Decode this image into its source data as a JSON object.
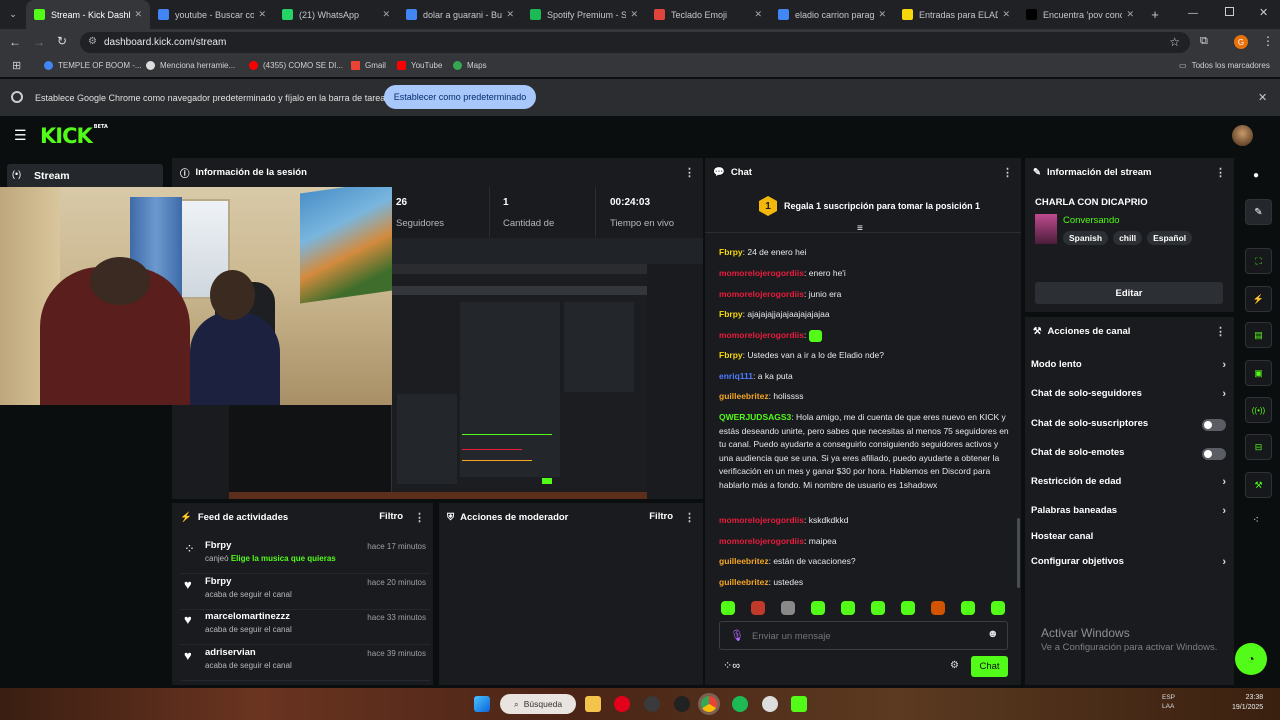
{
  "browser": {
    "tabs": [
      {
        "title": "Stream - Kick Dashboard",
        "active": true,
        "color": "#53fc18"
      },
      {
        "title": "youtube - Buscar con Google",
        "active": false,
        "color": "#4285f4"
      },
      {
        "title": "(21) WhatsApp",
        "active": false,
        "color": "#25d366"
      },
      {
        "title": "dolar a guarani - Buscar con Google",
        "active": false,
        "color": "#4285f4"
      },
      {
        "title": "Spotify Premium - Spotify",
        "active": false,
        "color": "#1db954"
      },
      {
        "title": "Teclado Emoji",
        "active": false,
        "color": "#e0443d"
      },
      {
        "title": "eladio carrion paraguay",
        "active": false,
        "color": "#4285f4"
      },
      {
        "title": "Entradas para ELADIO",
        "active": false,
        "color": "#f5d70b"
      },
      {
        "title": "Encuentra 'pov concierto'",
        "active": false,
        "color": "#000000"
      }
    ],
    "url": "dashboard.kick.com/stream",
    "bookmarks": [
      "TEMPLE OF BOOM -...",
      "Menciona herramie...",
      "(4355) COMO SE DI...",
      "Gmail",
      "YouTube",
      "Maps"
    ],
    "bookmarks_all": "Todos los marcadores",
    "profile_letter": "G",
    "infobar_text": "Establece Google Chrome como navegador predeterminado y fíjalo en la barra de tareas",
    "infobar_button": "Establecer como predeterminado"
  },
  "kick": {
    "logo": "KICK",
    "logo_badge": "BETA",
    "nav_stream": "Stream",
    "session": {
      "title": "Información de la sesión",
      "stats": [
        {
          "value": "26",
          "label": "Seguidores"
        },
        {
          "value": "1",
          "label": "Cantidad de"
        },
        {
          "value": "00:24:03",
          "label": "Tiempo en vivo"
        }
      ]
    },
    "chat": {
      "title": "Chat",
      "pinned": "Regala 1 suscripción para tomar la posición 1",
      "pinned_rank": "1",
      "messages": [
        {
          "user": "Fbrpy",
          "color": "#f5d70b",
          "text": "24 de enero hei"
        },
        {
          "user": "momorelojerogordiis",
          "color": "#e91c3c",
          "text": "enero he'i"
        },
        {
          "user": "momorelojerogordiis",
          "color": "#e91c3c",
          "text": "junio era"
        },
        {
          "user": "Fbrpy",
          "color": "#f5d70b",
          "text": "ajajajajjajajaajajajajaa"
        },
        {
          "user": "momorelojerogordiis",
          "color": "#e91c3c",
          "text": ""
        },
        {
          "user": "Fbrpy",
          "color": "#f5d70b",
          "text": "Ustedes van a ir a lo de Eladio nde?"
        },
        {
          "user": "enriq111",
          "color": "#4f7cff",
          "text": "a ka puta"
        },
        {
          "user": "guilleebritez",
          "color": "#f5a623",
          "text": "holissss"
        },
        {
          "user": "QWERJUDSAGS3",
          "color": "#53fc18",
          "text": "Hola amigo, me di cuenta de que eres nuevo en KICK y estás deseando unirte, pero sabes que necesitas al menos 75 seguidores en tu canal. Puedo ayudarte a conseguirlo consiguiendo seguidores activos y una audiencia que se una. Si ya eres afiliado, puedo ayudarte a obtener la verificación en un mes y ganar $30 por hora. Hablemos en Discord para hablarlo más a fondo. Mi nombre de usuario es 1shadowx"
        },
        {
          "user": "momorelojerogordiis",
          "color": "#e91c3c",
          "text": "kskdkdkkd"
        },
        {
          "user": "momorelojerogordiis",
          "color": "#e91c3c",
          "text": "maipea"
        },
        {
          "user": "guilleebritez",
          "color": "#f5a623",
          "text": "están de vacaciones?"
        },
        {
          "user": "guilleebritez",
          "color": "#f5a623",
          "text": "ustedes"
        }
      ],
      "input_placeholder": "Enviar un mensaje",
      "send_button": "Chat"
    },
    "stream_info": {
      "title": "Información del stream",
      "stream_title": "CHARLA CON DICAPRIO",
      "category": "Conversando",
      "tags": [
        "Spanish",
        "chill",
        "Español"
      ],
      "edit_button": "Editar"
    },
    "channel_actions": {
      "title": "Acciones de canal",
      "items": [
        {
          "label": "Modo lento",
          "control": "chevron"
        },
        {
          "label": "Chat de solo-seguidores",
          "control": "chevron"
        },
        {
          "label": "Chat de solo-suscriptores",
          "control": "toggle"
        },
        {
          "label": "Chat de solo-emotes",
          "control": "toggle"
        },
        {
          "label": "Restricción de edad",
          "control": "chevron"
        },
        {
          "label": "Palabras baneadas",
          "control": "chevron"
        },
        {
          "label": "Hostear canal",
          "control": "none"
        },
        {
          "label": "Configurar objetivos",
          "control": "chevron"
        }
      ]
    },
    "activity": {
      "title": "Feed de actividades",
      "filter": "Filtro",
      "items": [
        {
          "name": "Fbrpy",
          "desc_prefix": "canjeó",
          "desc_highlight": "Elige la musica que quieras",
          "time": "hace 17 minutos",
          "icon": "redeem-icon"
        },
        {
          "name": "Fbrpy",
          "desc_prefix": "acaba de seguir el canal",
          "desc_highlight": "",
          "time": "hace 20 minutos",
          "icon": "heart-icon"
        },
        {
          "name": "marcelomartinezzz",
          "desc_prefix": "acaba de seguir el canal",
          "desc_highlight": "",
          "time": "hace 33 minutos",
          "icon": "heart-icon"
        },
        {
          "name": "adriservian",
          "desc_prefix": "acaba de seguir el canal",
          "desc_highlight": "",
          "time": "hace 39 minutos",
          "icon": "heart-icon"
        }
      ]
    },
    "moderator": {
      "title": "Acciones de moderador",
      "filter": "Filtro"
    }
  },
  "windows": {
    "activate_title": "Activar Windows",
    "activate_sub": "Ve a Configuración para activar Windows.",
    "search": "Búsqueda",
    "lang": "ESP\nLAA",
    "time": "23:38",
    "date": "19/1/2025"
  },
  "colors": {
    "kick_green": "#53fc18",
    "panel_bg": "#191b1f",
    "page_bg": "#0b0e0f"
  }
}
